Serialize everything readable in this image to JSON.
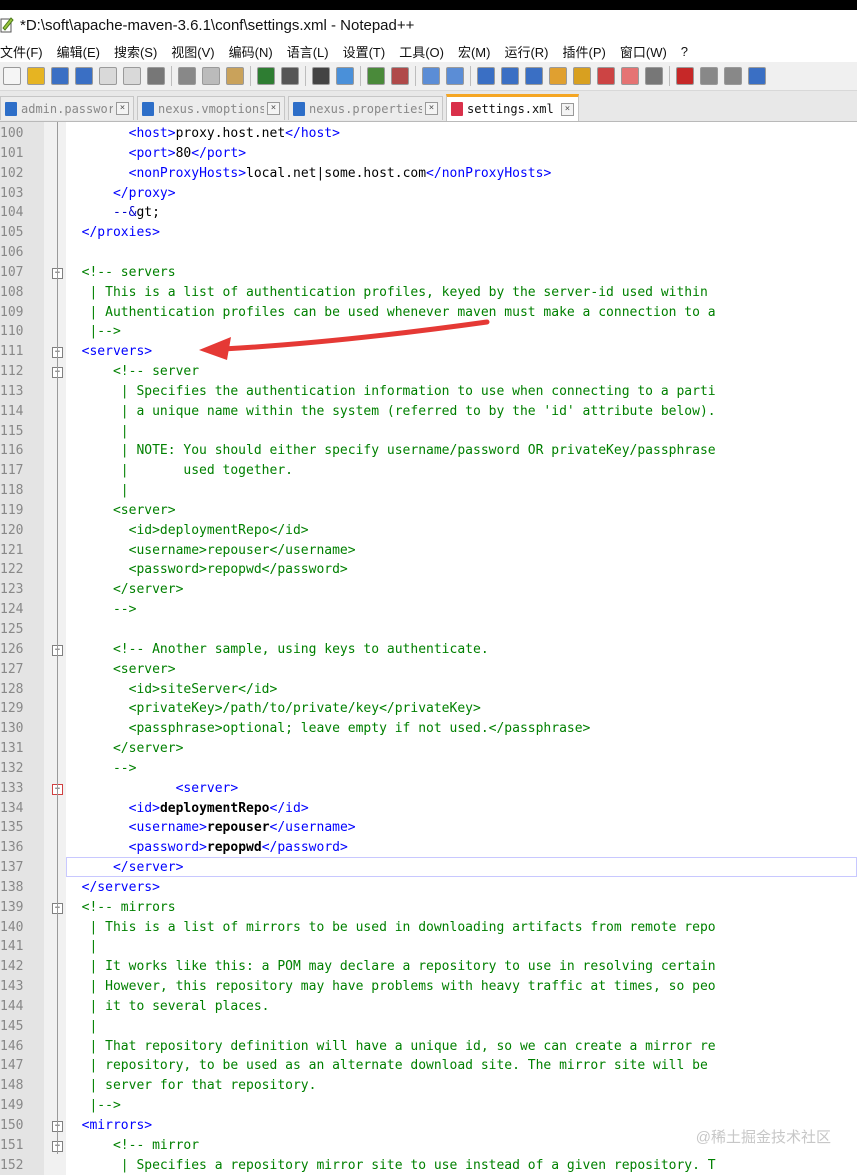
{
  "window": {
    "title": "*D:\\soft\\apache-maven-3.6.1\\conf\\settings.xml - Notepad++"
  },
  "menu": [
    {
      "label": "文件(F)"
    },
    {
      "label": "编辑(E)"
    },
    {
      "label": "搜索(S)"
    },
    {
      "label": "视图(V)"
    },
    {
      "label": "编码(N)"
    },
    {
      "label": "语言(L)"
    },
    {
      "label": "设置(T)"
    },
    {
      "label": "工具(O)"
    },
    {
      "label": "宏(M)"
    },
    {
      "label": "运行(R)"
    },
    {
      "label": "插件(P)"
    },
    {
      "label": "窗口(W)"
    },
    {
      "label": "?"
    }
  ],
  "tabs": [
    {
      "label": "admin.password",
      "active": false,
      "icon_color": "#2d6ec8"
    },
    {
      "label": "nexus.vmoptions",
      "active": false,
      "icon_color": "#2d6ec8"
    },
    {
      "label": "nexus.properties",
      "active": false,
      "icon_color": "#2d6ec8"
    },
    {
      "label": "settings.xml",
      "active": true,
      "icon_color": "#d9304a"
    }
  ],
  "colors": {
    "comment": "#008000",
    "tag": "#0000ff",
    "annotation_arrow": "#e53935"
  },
  "editor": {
    "lines": [
      {
        "num": "100",
        "text": "        <host>proxy.host.net</host>"
      },
      {
        "num": "101",
        "text": "        <port>80</port>"
      },
      {
        "num": "102",
        "text": "        <nonProxyHosts>local.net|some.host.com</nonProxyHosts>"
      },
      {
        "num": "103",
        "text": "      </proxy>"
      },
      {
        "num": "104",
        "text": "      -->"
      },
      {
        "num": "105",
        "text": "  </proxies>"
      },
      {
        "num": "106",
        "text": ""
      },
      {
        "num": "107",
        "text": "  <!-- servers"
      },
      {
        "num": "108",
        "text": "   | This is a list of authentication profiles, keyed by the server-id used within"
      },
      {
        "num": "109",
        "text": "   | Authentication profiles can be used whenever maven must make a connection to a"
      },
      {
        "num": "110",
        "text": "   |-->"
      },
      {
        "num": "111",
        "text": "  <servers>"
      },
      {
        "num": "112",
        "text": "      <!-- server"
      },
      {
        "num": "113",
        "text": "       | Specifies the authentication information to use when connecting to a parti"
      },
      {
        "num": "114",
        "text": "       | a unique name within the system (referred to by the 'id' attribute below)."
      },
      {
        "num": "115",
        "text": "       |"
      },
      {
        "num": "116",
        "text": "       | NOTE: You should either specify username/password OR privateKey/passphrase"
      },
      {
        "num": "117",
        "text": "       |       used together."
      },
      {
        "num": "118",
        "text": "       |"
      },
      {
        "num": "119",
        "text": "      <server>"
      },
      {
        "num": "120",
        "text": "        <id>deploymentRepo</id>"
      },
      {
        "num": "121",
        "text": "        <username>repouser</username>"
      },
      {
        "num": "122",
        "text": "        <password>repopwd</password>"
      },
      {
        "num": "123",
        "text": "      </server>"
      },
      {
        "num": "124",
        "text": "      -->"
      },
      {
        "num": "125",
        "text": ""
      },
      {
        "num": "126",
        "text": "      <!-- Another sample, using keys to authenticate."
      },
      {
        "num": "127",
        "text": "      <server>"
      },
      {
        "num": "128",
        "text": "        <id>siteServer</id>"
      },
      {
        "num": "129",
        "text": "        <privateKey>/path/to/private/key</privateKey>"
      },
      {
        "num": "130",
        "text": "        <passphrase>optional; leave empty if not used.</passphrase>"
      },
      {
        "num": "131",
        "text": "      </server>"
      },
      {
        "num": "132",
        "text": "      -->"
      },
      {
        "num": "133",
        "text": "              <server>"
      },
      {
        "num": "134",
        "text": "        <id>deploymentRepo</id>"
      },
      {
        "num": "135",
        "text": "        <username>repouser</username>"
      },
      {
        "num": "136",
        "text": "        <password>repopwd</password>"
      },
      {
        "num": "137",
        "text": "      </server>"
      },
      {
        "num": "138",
        "text": "  </servers>"
      },
      {
        "num": "139",
        "text": "  <!-- mirrors"
      },
      {
        "num": "140",
        "text": "   | This is a list of mirrors to be used in downloading artifacts from remote repo"
      },
      {
        "num": "141",
        "text": "   |"
      },
      {
        "num": "142",
        "text": "   | It works like this: a POM may declare a repository to use in resolving certain"
      },
      {
        "num": "143",
        "text": "   | However, this repository may have problems with heavy traffic at times, so peo"
      },
      {
        "num": "144",
        "text": "   | it to several places."
      },
      {
        "num": "145",
        "text": "   |"
      },
      {
        "num": "146",
        "text": "   | That repository definition will have a unique id, so we can create a mirror re"
      },
      {
        "num": "147",
        "text": "   | repository, to be used as an alternate download site. The mirror site will be"
      },
      {
        "num": "148",
        "text": "   | server for that repository."
      },
      {
        "num": "149",
        "text": "   |-->"
      },
      {
        "num": "150",
        "text": "  <mirrors>"
      },
      {
        "num": "151",
        "text": "      <!-- mirror"
      },
      {
        "num": "152",
        "text": "       | Specifies a repository mirror site to use instead of a given repository. T"
      }
    ]
  },
  "watermark": "@稀土掘金技术社区"
}
